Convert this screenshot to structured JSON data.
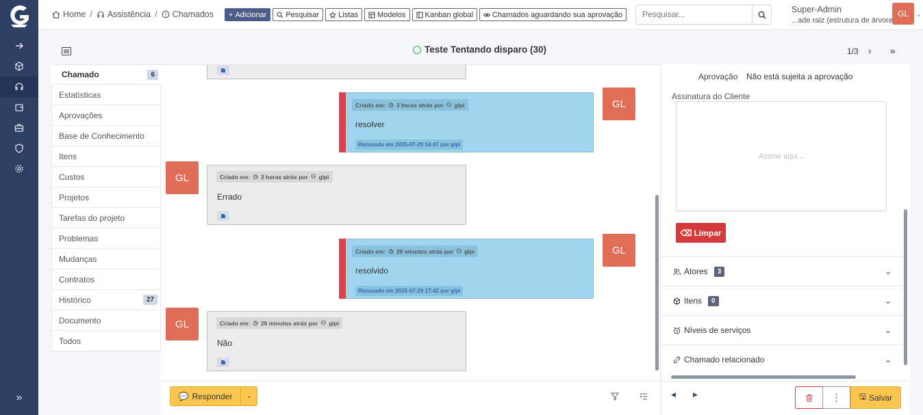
{
  "header": {
    "breadcrumbs": [
      "Home",
      "Assistência",
      "Chamados"
    ],
    "toolbar": {
      "add": "Adicionar",
      "search": "Pesquisar",
      "lists": "Listas",
      "models": "Modelos",
      "kanban": "Kanban global",
      "awaiting": "Chamados aguardando sua aprovação"
    },
    "search_placeholder": "Pesquisar...",
    "user": {
      "name": "Super-Admin",
      "entity": "...ade raiz (estrutura de árvore)",
      "initials": "GL"
    }
  },
  "ticket": {
    "title": "Teste Tentando disparo (30)",
    "pager": "1/3"
  },
  "tabs": [
    {
      "label": "Chamado",
      "count": "6"
    },
    {
      "label": "Estatísticas"
    },
    {
      "label": "Aprovações"
    },
    {
      "label": "Base de Conhecimento"
    },
    {
      "label": "Itens"
    },
    {
      "label": "Custos"
    },
    {
      "label": "Projetos"
    },
    {
      "label": "Tarefas do projeto"
    },
    {
      "label": "Problemas"
    },
    {
      "label": "Mudanças"
    },
    {
      "label": "Contratos"
    },
    {
      "label": "Histórico",
      "count": "27"
    },
    {
      "label": "Documento"
    },
    {
      "label": "Todos"
    }
  ],
  "timeline": [
    {
      "created_label": "Criado em:",
      "when": "3 horas atrás por",
      "author": "glpi",
      "text": "resolver",
      "refused": "Recusado em 2025-07-29 14:47 por glpi",
      "initials": "GL"
    },
    {
      "created_label": "Criado em:",
      "when": "3 horas atrás por",
      "author": "glpi",
      "text": "Errado",
      "initials": "GL"
    },
    {
      "created_label": "Criado em:",
      "when": "29 minutos atrás por",
      "author": "glpi",
      "text": "resolvido",
      "refused": "Recusado em 2025-07-29 17:42 por glpi",
      "initials": "GL"
    },
    {
      "created_label": "Criado em:",
      "when": "28 minutos atrás por",
      "author": "glpi",
      "text": "Não",
      "initials": "GL"
    }
  ],
  "actions": {
    "answer": "Responder",
    "save": "Salvar"
  },
  "right": {
    "approval_label": "Aprovação",
    "approval_value": "Não está sujeita a aprovação",
    "signature_label": "Assinatura do Cliente",
    "signature_placeholder": "Assine aqui...",
    "clear": "Limpar",
    "sections": [
      {
        "label": "Atores",
        "count": "3"
      },
      {
        "label": "Itens",
        "count": "0"
      },
      {
        "label": "Níveis de serviços"
      },
      {
        "label": "Chamado relacionado"
      }
    ]
  },
  "colors": {
    "sidebar": "#2f3f64",
    "accent": "#fbc650",
    "avatar": "#e06d57",
    "danger": "#d63939",
    "solution_bg": "#9fd5ee"
  }
}
